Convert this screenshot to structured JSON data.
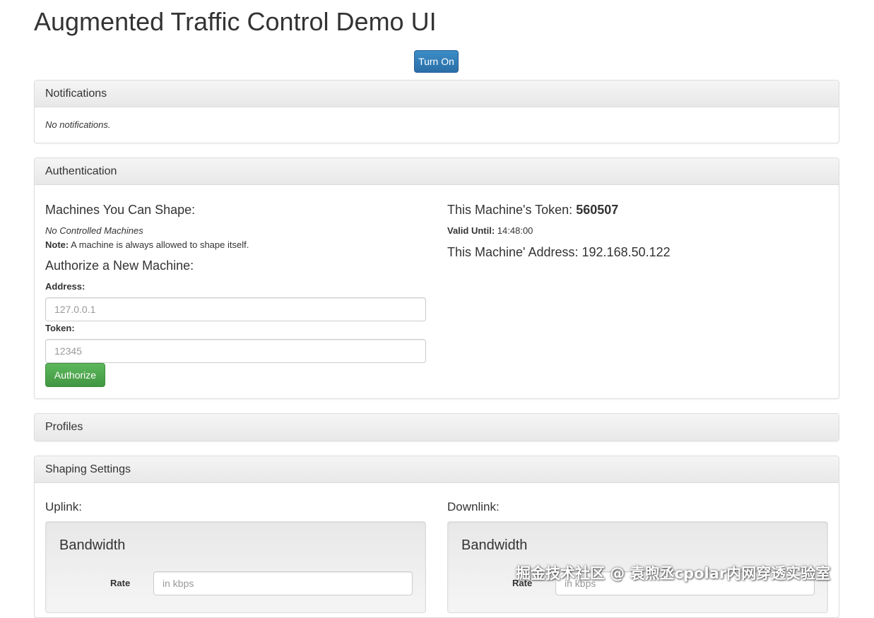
{
  "page_title": "Augmented Traffic Control Demo UI",
  "turn_on_label": "Turn On",
  "notifications": {
    "heading": "Notifications",
    "empty_text": "No notifications."
  },
  "authentication": {
    "heading": "Authentication",
    "machines_title": "Machines You Can Shape:",
    "no_machines": "No Controlled Machines",
    "note_label": "Note:",
    "note_text": "A machine is always allowed to shape itself.",
    "authorize_title": "Authorize a New Machine:",
    "address_label": "Address:",
    "address_placeholder": "127.0.0.1",
    "token_label": "Token:",
    "token_placeholder": "12345",
    "authorize_button": "Authorize",
    "token_title": "This Machine's Token:",
    "token_value": "560507",
    "valid_until_label": "Valid Until:",
    "valid_until_value": "14:48:00",
    "address_line": "This Machine' Address: 192.168.50.122"
  },
  "profiles": {
    "heading": "Profiles"
  },
  "shaping": {
    "heading": "Shaping Settings",
    "uplink_label": "Uplink:",
    "downlink_label": "Downlink:",
    "uplink": {
      "section_title": "Bandwidth",
      "rate_label": "Rate",
      "rate_placeholder": "in kbps"
    },
    "downlink": {
      "section_title": "Bandwidth",
      "rate_label": "Rate",
      "rate_placeholder": "in kbps"
    }
  },
  "watermark": "掘金技术社区 @ 袁煦丞cpolar内网穿透实验室"
}
